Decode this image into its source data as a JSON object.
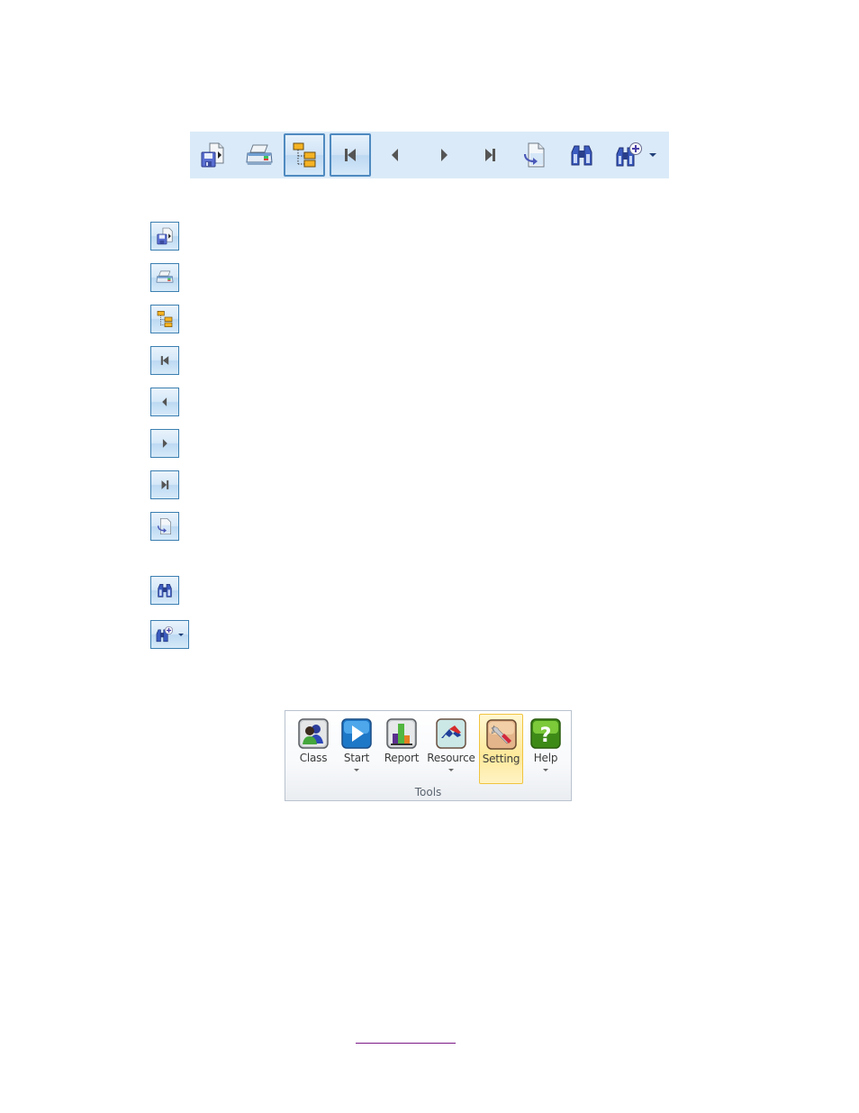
{
  "toolbar": {
    "background": "#dbeaf8",
    "buttons": [
      {
        "name": "export",
        "icon": "export-save-icon",
        "pressed": false
      },
      {
        "name": "print",
        "icon": "printer-icon",
        "pressed": false
      },
      {
        "name": "tree",
        "icon": "tree-view-icon",
        "pressed": true
      },
      {
        "name": "first",
        "icon": "first-page-icon",
        "pressed": true
      },
      {
        "name": "previous",
        "icon": "previous-page-icon",
        "pressed": false
      },
      {
        "name": "next",
        "icon": "next-page-icon",
        "pressed": false
      },
      {
        "name": "last",
        "icon": "last-page-icon",
        "pressed": false
      },
      {
        "name": "goto",
        "icon": "goto-page-icon",
        "pressed": false
      },
      {
        "name": "find",
        "icon": "binoculars-icon",
        "pressed": false
      },
      {
        "name": "find-more",
        "icon": "binoculars-plus-icon",
        "pressed": false,
        "has_dropdown": true
      }
    ]
  },
  "icon_list": [
    "export-save-icon",
    "printer-icon",
    "tree-view-icon",
    "first-page-icon",
    "previous-page-icon",
    "next-page-icon",
    "last-page-icon",
    "goto-page-icon",
    "binoculars-icon",
    "binoculars-plus-icon"
  ],
  "ribbon": {
    "group_label": "Tools",
    "items": [
      {
        "label": "Class",
        "icon": "class-users-icon",
        "dropdown": false,
        "active": false
      },
      {
        "label": "Start",
        "icon": "start-play-icon",
        "dropdown": true,
        "active": false
      },
      {
        "label": "Report",
        "icon": "report-chart-icon",
        "dropdown": false,
        "active": false
      },
      {
        "label": "Resource",
        "icon": "resource-icon",
        "dropdown": true,
        "active": false
      },
      {
        "label": "Setting",
        "icon": "setting-wrench-icon",
        "dropdown": false,
        "active": true
      },
      {
        "label": "Help",
        "icon": "help-question-icon",
        "dropdown": true,
        "active": false
      }
    ]
  },
  "colors": {
    "toolbar_bg": "#dbeaf8",
    "pressed_border": "#4f8ac0",
    "active_ribbon_border": "#f1c43f",
    "link_underline": "#7b1a86"
  }
}
